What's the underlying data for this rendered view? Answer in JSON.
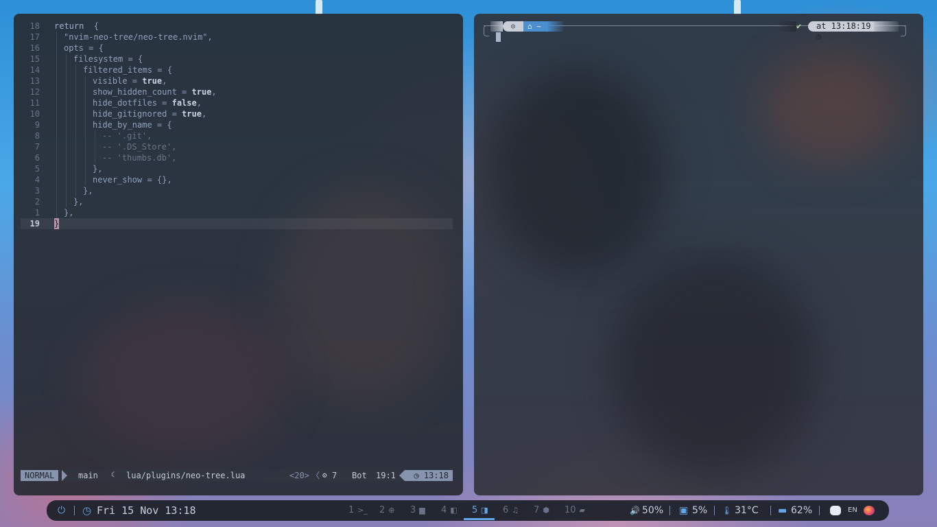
{
  "editor": {
    "lines": [
      {
        "num": "18",
        "segments": [
          [
            "kw",
            "return"
          ],
          [
            "",
            "  {"
          ]
        ],
        "indent": 0
      },
      {
        "num": "17",
        "segments": [
          [
            "str",
            "\"nvim-neo-tree/neo-tree.nvim\""
          ],
          [
            "",
            ","
          ]
        ],
        "indent": 1
      },
      {
        "num": "16",
        "segments": [
          [
            "",
            "opts = {"
          ]
        ],
        "indent": 1
      },
      {
        "num": "15",
        "segments": [
          [
            "",
            "filesystem = {"
          ]
        ],
        "indent": 2
      },
      {
        "num": "14",
        "segments": [
          [
            "",
            "filtered_items = {"
          ]
        ],
        "indent": 3
      },
      {
        "num": "13",
        "segments": [
          [
            "",
            "visible = "
          ],
          [
            "bool",
            "true"
          ],
          [
            "",
            ","
          ]
        ],
        "indent": 4
      },
      {
        "num": "12",
        "segments": [
          [
            "",
            "show_hidden_count = "
          ],
          [
            "bool",
            "true"
          ],
          [
            "",
            ","
          ]
        ],
        "indent": 4
      },
      {
        "num": "11",
        "segments": [
          [
            "",
            "hide_dotfiles = "
          ],
          [
            "bool",
            "false"
          ],
          [
            "",
            ","
          ]
        ],
        "indent": 4
      },
      {
        "num": "10",
        "segments": [
          [
            "",
            "hide_gitignored = "
          ],
          [
            "bool",
            "true"
          ],
          [
            "",
            ","
          ]
        ],
        "indent": 4
      },
      {
        "num": "9",
        "segments": [
          [
            "",
            "hide_by_name = {"
          ]
        ],
        "indent": 4
      },
      {
        "num": "8",
        "segments": [
          [
            "cmt",
            "-- '.git',"
          ]
        ],
        "indent": 5
      },
      {
        "num": "7",
        "segments": [
          [
            "cmt",
            "-- '.DS_Store',"
          ]
        ],
        "indent": 5
      },
      {
        "num": "6",
        "segments": [
          [
            "cmt",
            "-- 'thumbs.db',"
          ]
        ],
        "indent": 5
      },
      {
        "num": "5",
        "segments": [
          [
            "",
            "},"
          ]
        ],
        "indent": 4
      },
      {
        "num": "4",
        "segments": [
          [
            "",
            "never_show = {},"
          ]
        ],
        "indent": 4
      },
      {
        "num": "3",
        "segments": [
          [
            "",
            "},"
          ]
        ],
        "indent": 3
      },
      {
        "num": "2",
        "segments": [
          [
            "",
            "},"
          ]
        ],
        "indent": 2
      },
      {
        "num": "1",
        "segments": [
          [
            "",
            "},"
          ]
        ],
        "indent": 1
      },
      {
        "num": "19",
        "segments": [
          [
            "cursor",
            "}"
          ]
        ],
        "indent": 0,
        "current": true
      }
    ]
  },
  "statusline": {
    "mode": "NORMAL",
    "branch_icon": "",
    "branch": "main",
    "file_icon": "☾",
    "file": "lua/plugins/neo-tree.lua",
    "buffers": "<20>",
    "diag_icon": "⚙",
    "diag_count": "7",
    "position": "Bot",
    "line_col": "19:1",
    "clock": "◷ 13:18"
  },
  "terminal": {
    "os_icon": "◎",
    "dir": "⌂ ~",
    "status_ok": "✔",
    "time": "at 13:18:19 ◷"
  },
  "bar": {
    "power_icon": "⏻",
    "clock_icon": "◷",
    "datetime": "Fri 15 Nov 13:18",
    "workspaces": [
      {
        "num": "1",
        "icon": "terminal-icon",
        "glyph": ">_"
      },
      {
        "num": "2",
        "icon": "globe-icon",
        "glyph": "⊕"
      },
      {
        "num": "3",
        "icon": "folder-icon",
        "glyph": "▆"
      },
      {
        "num": "4",
        "icon": "window-icon",
        "glyph": "◧"
      },
      {
        "num": "5",
        "icon": "editor-icon",
        "glyph": "◨",
        "active": true
      },
      {
        "num": "6",
        "icon": "music-icon",
        "glyph": "♫"
      },
      {
        "num": "7",
        "icon": "box-icon",
        "glyph": "⬢"
      },
      {
        "num": "10",
        "icon": "chat-icon",
        "glyph": "▰"
      }
    ],
    "volume_icon": "🔊",
    "volume": "50%",
    "cpu_icon": "▣",
    "cpu": "5%",
    "temp_icon": "🌡",
    "temp": "31°C",
    "memory_icon": "▬",
    "memory": "62%",
    "keyboard_layout": "EN"
  },
  "colors": {
    "accent": "#64a6e8",
    "mode_bg": "#8794ad"
  }
}
